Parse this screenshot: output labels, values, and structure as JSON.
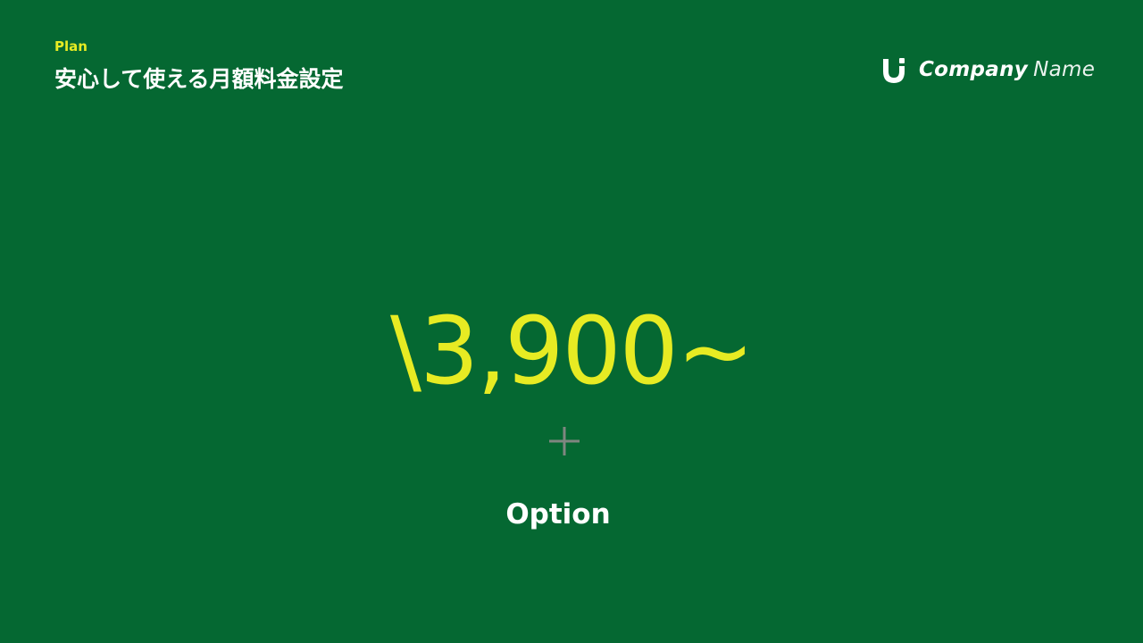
{
  "theme": {
    "background": "#056832",
    "accent": "#E7EB23",
    "text": "#FFFFFF",
    "plus_color": "#7F8680"
  },
  "header": {
    "section_label": "Plan",
    "title": "安心して使える月額料金設定"
  },
  "logo": {
    "icon": "company-logo-icon",
    "bold_text": "Company",
    "light_text": "Name"
  },
  "main": {
    "price": "\\3,900~",
    "plus_icon": "plus-icon",
    "option_label": "Option"
  }
}
